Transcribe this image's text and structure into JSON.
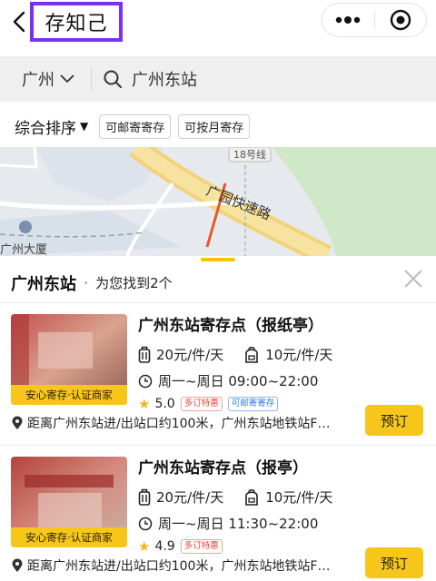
{
  "header": {
    "title": "存知己",
    "accent": "#7b2ff2",
    "icons": {
      "back": "back-arrow-icon",
      "more": "more-dots-icon",
      "close": "target-close-icon"
    }
  },
  "search": {
    "city": "广州",
    "query": "广州东站"
  },
  "filters": {
    "sort_label": "综合排序",
    "chips": [
      "可邮寄寄存",
      "可按月寄存"
    ]
  },
  "map": {
    "labels": [
      "18号线",
      "广园快速路",
      "广州大厦"
    ]
  },
  "results": {
    "station": "广州东站",
    "count_text": "为您找到2个",
    "items": [
      {
        "badge": "安心寄存·认证商家",
        "name": "广州东站寄存点（报纸亭）",
        "price_bag": "20元/件/天",
        "price_pack": "10元/件/天",
        "hours": "周一~周日 09:00~22:00",
        "rating": "5.0",
        "tags": [
          "多订特惠",
          "可邮寄寄存"
        ],
        "address": "距离广州东站进/出站口约100米，广州东站地铁站F…",
        "book_label": "预订"
      },
      {
        "badge": "安心寄存·认证商家",
        "name": "广州东站寄存点（报亭）",
        "price_bag": "20元/件/天",
        "price_pack": "10元/件/天",
        "hours": "周一~周日 11:30~22:00",
        "rating": "4.9",
        "tags": [
          "多订特惠"
        ],
        "address": "距离广州东站进/出站口约100米，广州东站地铁站F…",
        "book_label": "预订"
      }
    ]
  },
  "colors": {
    "yellow": "#f6c61a",
    "tag_red": "#e6433a",
    "tag_blue": "#3477e5"
  }
}
